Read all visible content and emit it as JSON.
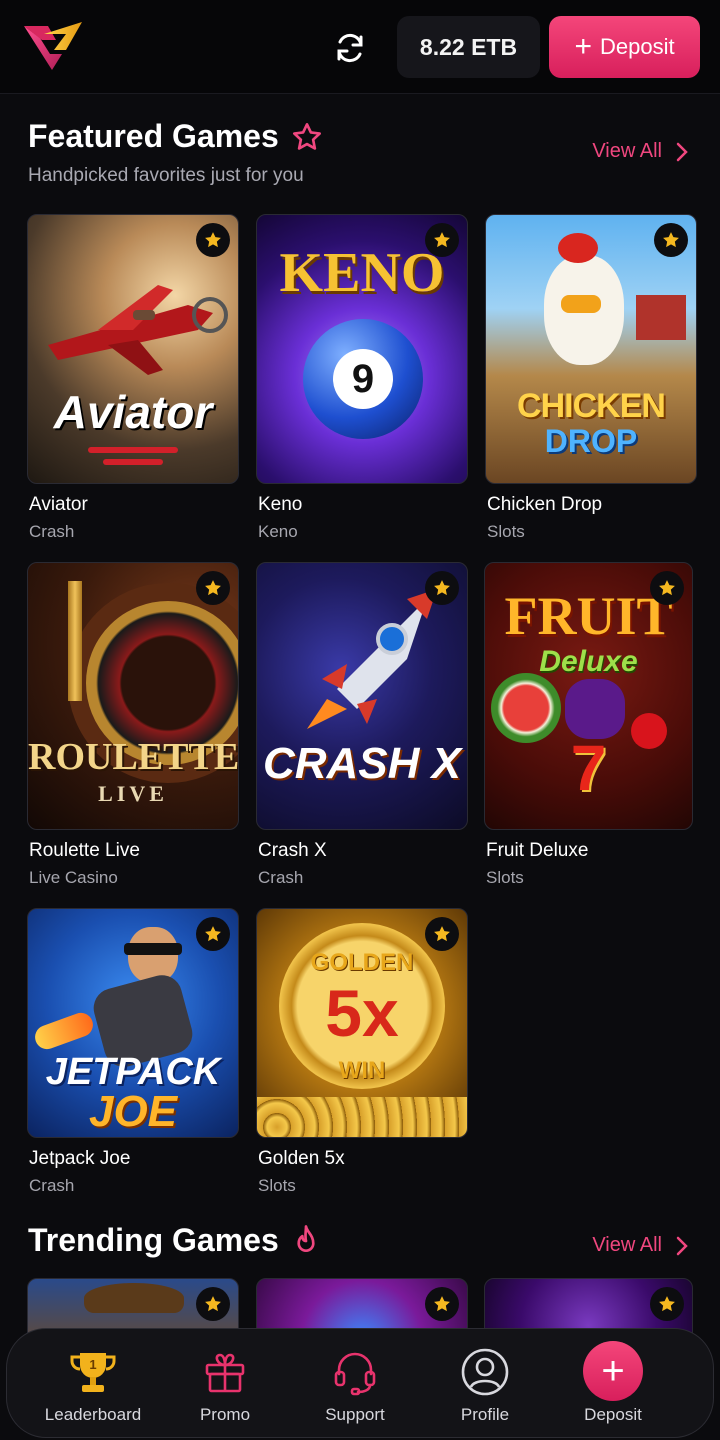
{
  "header": {
    "balance": "8.22 ETB",
    "deposit_label": "Deposit"
  },
  "featured": {
    "title": "Featured Games",
    "subtitle": "Handpicked favorites just for you",
    "view_all": "View All",
    "games": [
      {
        "name": "Aviator",
        "category": "Crash",
        "art_text": "Aviator"
      },
      {
        "name": "Keno",
        "category": "Keno",
        "art_text": "KENO",
        "art_number": "9"
      },
      {
        "name": "Chicken Drop",
        "category": "Slots",
        "art_text": "CHICKEN",
        "art_text2": "DROP"
      },
      {
        "name": "Roulette Live",
        "category": "Live Casino",
        "art_text": "ROULETTE",
        "art_text2": "LIVE"
      },
      {
        "name": "Crash X",
        "category": "Crash",
        "art_text": "CRASH X"
      },
      {
        "name": "Fruit Deluxe",
        "category": "Slots",
        "art_text": "FRUIT",
        "art_text2": "Deluxe",
        "art_number": "7"
      },
      {
        "name": "Jetpack Joe",
        "category": "Crash",
        "art_text": "JETPACK",
        "art_text2": "JOE"
      },
      {
        "name": "Golden 5x",
        "category": "Slots",
        "art_text": "GOLDEN",
        "art_number": "5x",
        "art_text2": "WIN"
      }
    ]
  },
  "trending": {
    "title": "Trending Games",
    "view_all": "View All"
  },
  "bottom_nav": {
    "items": [
      {
        "label": "Leaderboard",
        "icon": "trophy-icon"
      },
      {
        "label": "Promo",
        "icon": "gift-icon"
      },
      {
        "label": "Support",
        "icon": "headset-icon"
      },
      {
        "label": "Profile",
        "icon": "user-icon"
      },
      {
        "label": "Deposit",
        "icon": "plus-icon"
      }
    ]
  },
  "colors": {
    "accent": "#e8336d",
    "background": "#0b0b0e",
    "star": "#f5b820"
  }
}
